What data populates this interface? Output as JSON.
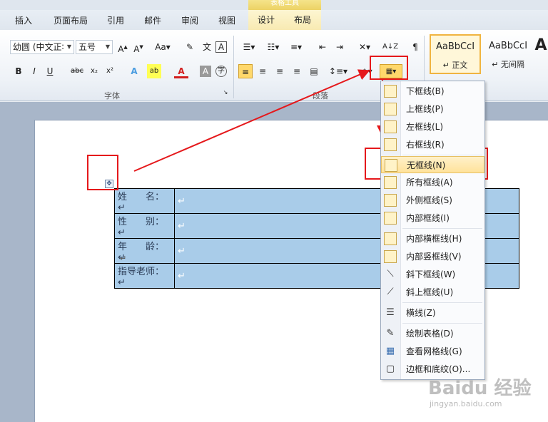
{
  "context_tab_header": "表格工具",
  "tabs": [
    {
      "label": "插入"
    },
    {
      "label": "页面布局"
    },
    {
      "label": "引用"
    },
    {
      "label": "邮件"
    },
    {
      "label": "审阅"
    },
    {
      "label": "视图"
    },
    {
      "label": "设计"
    },
    {
      "label": "布局"
    }
  ],
  "font": {
    "name": "幼圆 (中文正∶",
    "size": "五号",
    "group_label": "字体"
  },
  "paragraph": {
    "group_label": "段落"
  },
  "styles": [
    {
      "preview": "AaBbCcI",
      "name": "↵ 正文"
    },
    {
      "preview": "AaBbCcI",
      "name": "↵ 无间隔"
    },
    {
      "preview": "A",
      "name": ""
    }
  ],
  "table_rows": [
    {
      "label": "姓　　名：↵",
      "value": "↵"
    },
    {
      "label": "性　　别：↵",
      "value": "↵"
    },
    {
      "label": "年　　龄：↵",
      "value": "↵"
    },
    {
      "label": "指导老师：↵",
      "value": "↵"
    }
  ],
  "after_table_mark": "↵",
  "border_menu": [
    {
      "label": "下框线(B)"
    },
    {
      "label": "上框线(P)"
    },
    {
      "label": "左框线(L)"
    },
    {
      "label": "右框线(R)"
    },
    {
      "label": "无框线(N)"
    },
    {
      "label": "所有框线(A)"
    },
    {
      "label": "外侧框线(S)"
    },
    {
      "label": "内部框线(I)"
    },
    {
      "label": "内部横框线(H)"
    },
    {
      "label": "内部竖框线(V)"
    },
    {
      "label": "斜下框线(W)"
    },
    {
      "label": "斜上框线(U)"
    },
    {
      "label": "横线(Z)"
    },
    {
      "label": "绘制表格(D)"
    },
    {
      "label": "查看网格线(G)"
    },
    {
      "label": "边框和底纹(O)..."
    }
  ],
  "watermark": "Baidu 经验",
  "watermark_url": "jingyan.baidu.com",
  "colors": {
    "annotation": "#e5181b",
    "highlight": "#ffe29b",
    "table_fill": "#a9cce9"
  }
}
